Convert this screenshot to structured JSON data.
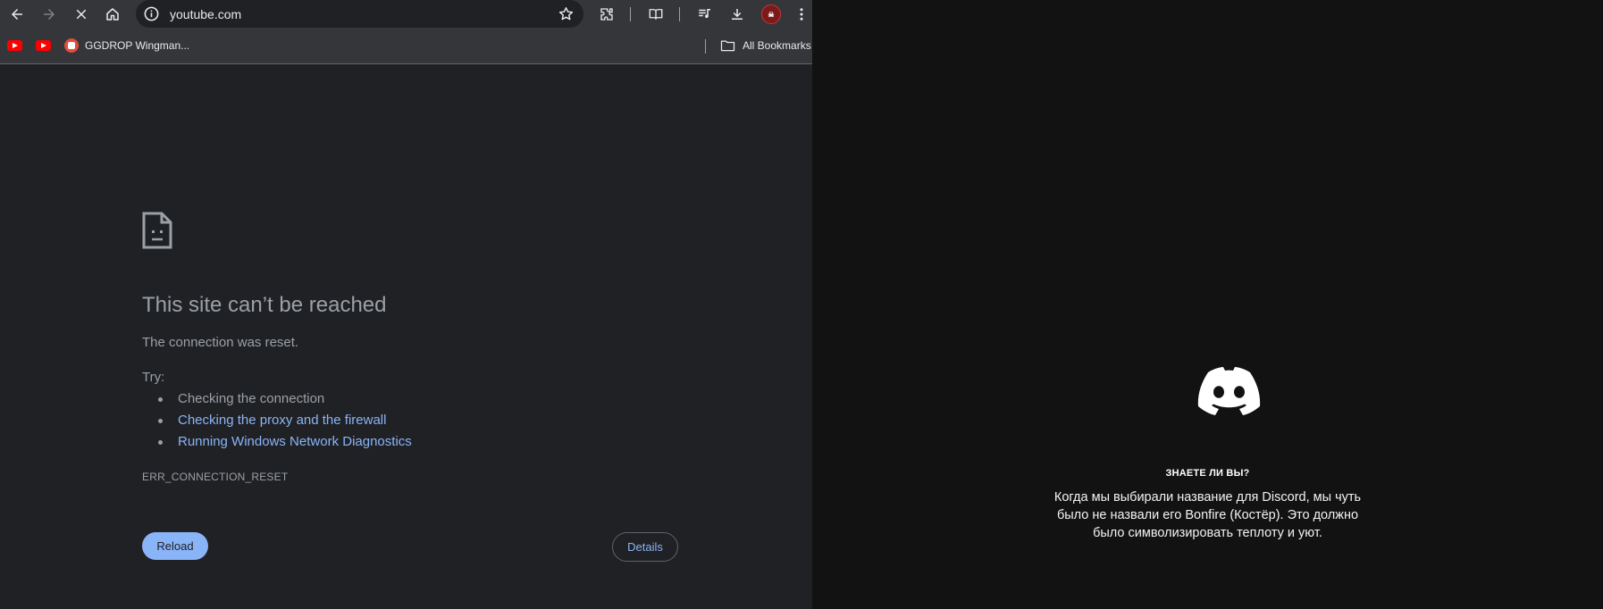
{
  "browser": {
    "address": "youtube.com",
    "bookmarks": {
      "item_label": "GGDROP Wingman...",
      "all_bookmarks": "All Bookmarks"
    },
    "error": {
      "title": "This site can’t be reached",
      "description": "The connection was reset.",
      "try_label": "Try:",
      "suggestions": [
        "Checking the connection",
        "Checking the proxy and the firewall",
        "Running Windows Network Diagnostics"
      ],
      "code": "ERR_CONNECTION_RESET",
      "reload_label": "Reload",
      "details_label": "Details"
    }
  },
  "discord": {
    "tip_title": "ЗНАЕТЕ ЛИ ВЫ?",
    "tip_body": "Когда мы выбирали название для Discord, мы чуть было не назвали его Bonfire (Костёр). Это должно было символизировать теплоту и уют."
  },
  "colors": {
    "link": "#8ab4f8",
    "error_text": "#9aa0a6",
    "page_bg": "#202124",
    "toolbar_bg": "#35363a",
    "discord_bg": "#121212"
  }
}
